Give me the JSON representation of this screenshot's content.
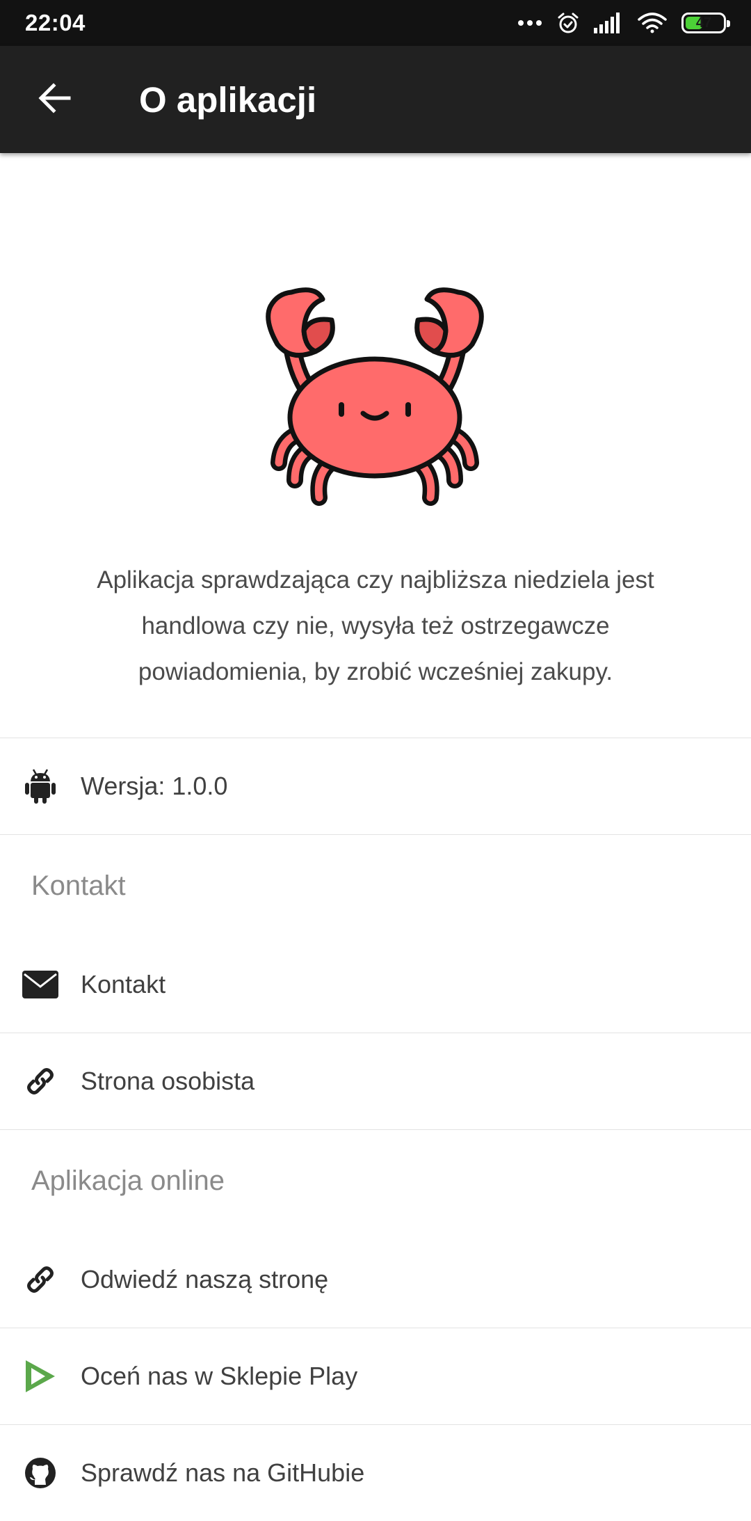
{
  "status_bar": {
    "time": "22:04",
    "battery": "47",
    "battery_level": 0.47,
    "icons": [
      "more-dots-icon",
      "alarm-icon",
      "signal-icon",
      "wifi-icon",
      "battery-icon"
    ]
  },
  "app_bar": {
    "title": "O aplikacji",
    "back_icon": "arrow-back-icon"
  },
  "hero": {
    "logo_icon": "crab-icon",
    "description": "Aplikacja sprawdzająca czy najbliższa niedziela jest handlowa czy nie, wysyła też ostrzegawcze powiadomienia, by zrobić wcześniej zakupy."
  },
  "version": {
    "icon": "android-icon",
    "label": "Wersja: 1.0.0"
  },
  "contact_section": {
    "header": "Kontakt",
    "items": [
      {
        "icon": "envelope-icon",
        "label": "Kontakt"
      },
      {
        "icon": "link-icon",
        "label": "Strona osobista"
      }
    ]
  },
  "online_section": {
    "header": "Aplikacja online",
    "items": [
      {
        "icon": "link-icon",
        "label": "Odwiedź naszą stronę"
      },
      {
        "icon": "play-store-icon",
        "label": "Oceń nas w Sklepie Play"
      },
      {
        "icon": "github-icon",
        "label": "Sprawdź nas na GitHubie"
      }
    ]
  },
  "colors": {
    "status_bar": "#121212",
    "app_bar": "#212121",
    "crab": "#ff6b6b",
    "crab_shade": "#e14d4d",
    "play_green": "#5ba84b",
    "battery_green": "#4cd137"
  }
}
